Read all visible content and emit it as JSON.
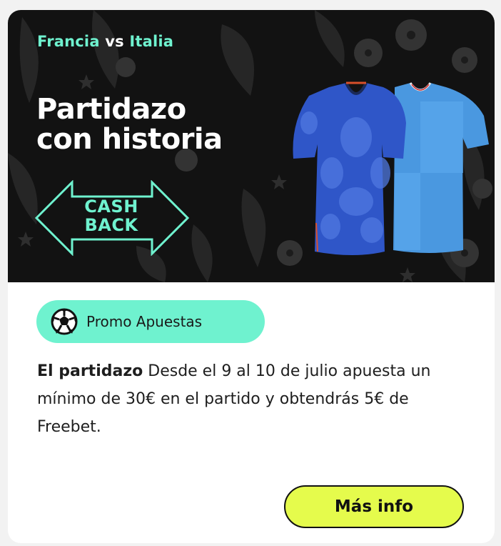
{
  "banner": {
    "team_home": "Francia",
    "vs": "vs",
    "team_away": "Italia",
    "headline_line1": "Partidazo",
    "headline_line2": "con historia",
    "cashback_line1": "CASH",
    "cashback_line2": "BACK"
  },
  "promo": {
    "tag_label": "Promo Apuestas",
    "description_bold": "El partidazo",
    "description_text": "Desde el 9 al 10 de julio apuesta un mínimo de 30€ en el partido y obtendrás 5€ de Freebet."
  },
  "actions": {
    "more_info_label": "Más info"
  },
  "colors": {
    "accent_mint": "#6ff2cf",
    "button_lime": "#e5fb4c",
    "banner_bg": "#121212",
    "jersey_france": "#2f56c8",
    "jersey_italy": "#4a98e0"
  },
  "icons": {
    "cashback": "double-arrow-icon",
    "promo": "soccer-ball-icon"
  }
}
